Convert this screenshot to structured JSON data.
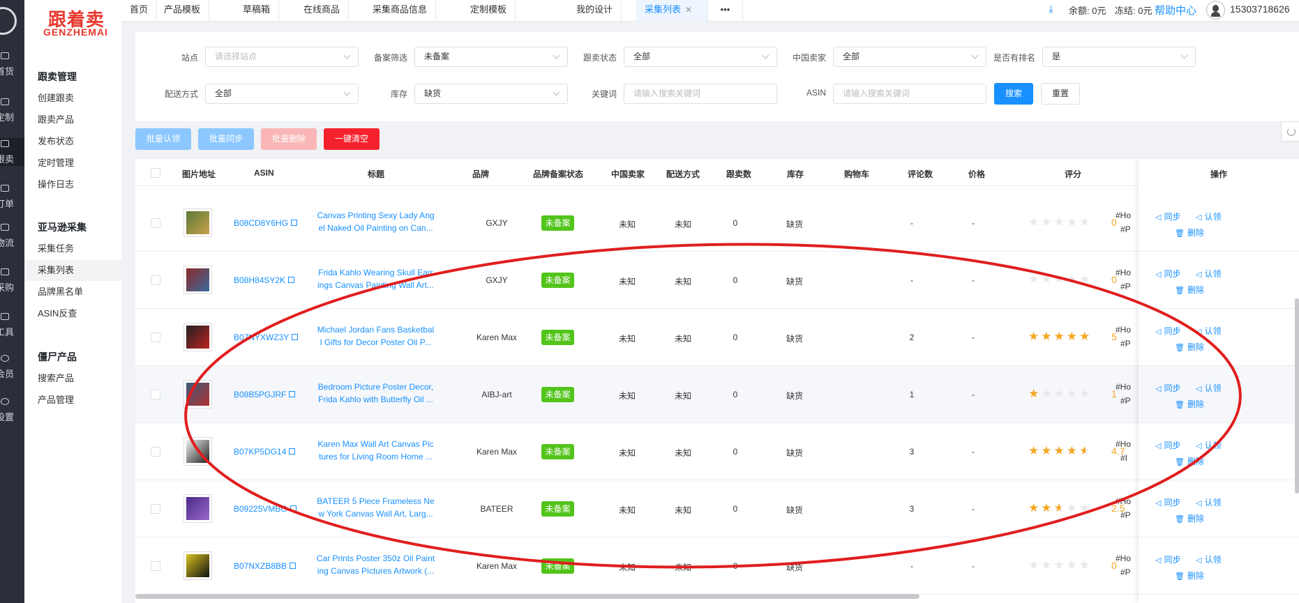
{
  "rail": {
    "items": [
      {
        "label": "首货",
        "icon": "list-icon"
      },
      {
        "label": "定制",
        "icon": "image-icon"
      },
      {
        "label": "跟卖",
        "icon": "list-icon"
      },
      {
        "label": "订单",
        "icon": "list-icon"
      },
      {
        "label": "物流",
        "icon": "home-icon"
      },
      {
        "label": "采购",
        "icon": "cart-icon"
      },
      {
        "label": "工具",
        "icon": "list-icon"
      },
      {
        "label": "会员",
        "icon": "search-icon"
      },
      {
        "label": "设置",
        "icon": "gear-icon"
      }
    ]
  },
  "logo": {
    "cn": "跟着卖",
    "en": "GENZHEMAI"
  },
  "menu": {
    "group1": "跟卖管理",
    "group1_items": [
      "创建跟卖",
      "跟卖产品",
      "发布状态",
      "定时管理",
      "操作日志"
    ],
    "group2": "亚马逊采集",
    "group2_items": [
      "采集任务",
      "采集列表",
      "品牌黑名单",
      "ASIN反查"
    ],
    "group3": "僵尸产品",
    "group3_items": [
      "搜索产品",
      "产品管理"
    ]
  },
  "tabs": [
    "首页",
    "产品模板",
    "草稿箱",
    "在线商品",
    "采集商品信息",
    "定制模板",
    "我的设计",
    "采集列表",
    "•••"
  ],
  "topbar": {
    "balance": "余额: 0元",
    "frozen": "冻结: 0元",
    "help": "帮助中心",
    "phone": "15303718626"
  },
  "filters": {
    "site_label": "站点",
    "site_placeholder": "请选择站点",
    "record_label": "备案筛选",
    "record_value": "未备案",
    "follow_label": "跟卖状态",
    "follow_value": "全部",
    "seller_label": "中国卖家",
    "seller_value": "全部",
    "rank_label": "是否有排名",
    "rank_value": "是",
    "ship_label": "配送方式",
    "ship_value": "全部",
    "stock_label": "库存",
    "stock_value": "缺货",
    "kw_label": "关键词",
    "kw_placeholder": "请输入搜索关键词",
    "asin_label": "ASIN",
    "asin_placeholder": "请输入搜索关键词",
    "search": "搜索",
    "reset": "重置"
  },
  "actions": {
    "batch_claim": "批量认领",
    "batch_sync": "批量同步",
    "batch_delete": "批量删除",
    "clear_all": "一键清空"
  },
  "columns": [
    "图片地址",
    "ASIN",
    "标题",
    "品牌",
    "品牌备案状态",
    "中国卖家",
    "配送方式",
    "跟卖数",
    "库存",
    "购物车",
    "评论数",
    "价格",
    "评分",
    "操作"
  ],
  "ops": {
    "sync": "同步",
    "claim": "认领",
    "delete": "删除"
  },
  "rows": [
    {
      "asin": "B08CD8Y6HG",
      "title1": "Canvas Printing Sexy Lady Ang",
      "title2": "el Naked Oil Painting on Can...",
      "brand": "GXJY",
      "status": "未备案",
      "cn": "未知",
      "ship": "未知",
      "follow": "0",
      "stock": "缺货",
      "reviews": "-",
      "price": "-",
      "rating": "0",
      "stars": 0,
      "tag1": "#Ho",
      "tag2": "#P"
    },
    {
      "asin": "B08H84SY2K",
      "title1": "Frida Kahlo Wearing Skull Earr",
      "title2": "ings Canvas Painting Wall Art...",
      "brand": "GXJY",
      "status": "未备案",
      "cn": "未知",
      "ship": "未知",
      "follow": "0",
      "stock": "缺货",
      "reviews": "-",
      "price": "-",
      "rating": "0",
      "stars": 0,
      "tag1": "#Ho",
      "tag2": "#P"
    },
    {
      "asin": "B07NYXWZ3Y",
      "title1": "Michael Jordan Fans Basketbal",
      "title2": "l Gifts for Decor Poster Oil P...",
      "brand": "Karen Max",
      "status": "未备案",
      "cn": "未知",
      "ship": "未知",
      "follow": "0",
      "stock": "缺货",
      "reviews": "2",
      "price": "-",
      "rating": "5",
      "stars": 5,
      "tag1": "#Ho",
      "tag2": "#P"
    },
    {
      "asin": "B08B5PGJRF",
      "title1": "Bedroom Picture Poster Decor,",
      "title2": "Frida Kahlo with Butterfly Oil ...",
      "brand": "AIBJ-art",
      "status": "未备案",
      "cn": "未知",
      "ship": "未知",
      "follow": "0",
      "stock": "缺货",
      "reviews": "1",
      "price": "-",
      "rating": "1",
      "stars": 1,
      "tag1": "#Ho",
      "tag2": "#P"
    },
    {
      "asin": "B07KP5DG14",
      "title1": "Karen Max Wall Art Canvas Pic",
      "title2": "tures for Living Room Home ...",
      "brand": "Karen Max",
      "status": "未备案",
      "cn": "未知",
      "ship": "未知",
      "follow": "0",
      "stock": "缺货",
      "reviews": "3",
      "price": "-",
      "rating": "4.7",
      "stars": 4.7,
      "tag1": "#Ho",
      "tag2": "#I"
    },
    {
      "asin": "B09225VMBG",
      "title1": "BATEER 5 Piece Frameless Ne",
      "title2": "w York Canvas Wall Art, Larg...",
      "brand": "BATEER",
      "status": "未备案",
      "cn": "未知",
      "ship": "未知",
      "follow": "0",
      "stock": "缺货",
      "reviews": "3",
      "price": "-",
      "rating": "2.5",
      "stars": 2.5,
      "tag1": "#Ho",
      "tag2": "#P"
    },
    {
      "asin": "B07NXZB8BB",
      "title1": "Car Prints Poster 350z Oil Paint",
      "title2": "ing Canvas Pictures Artwork (...",
      "brand": "Karen Max",
      "status": "未备案",
      "cn": "未知",
      "ship": "未知",
      "follow": "0",
      "stock": "缺货",
      "reviews": "-",
      "price": "-",
      "rating": "0",
      "stars": 0,
      "tag1": "#Ho",
      "tag2": "#P"
    }
  ],
  "colors": {
    "primary": "#1890ff",
    "danger": "#f5222d",
    "success": "#52c41a",
    "star": "#f5a623",
    "annotation": "#e01e1e"
  }
}
